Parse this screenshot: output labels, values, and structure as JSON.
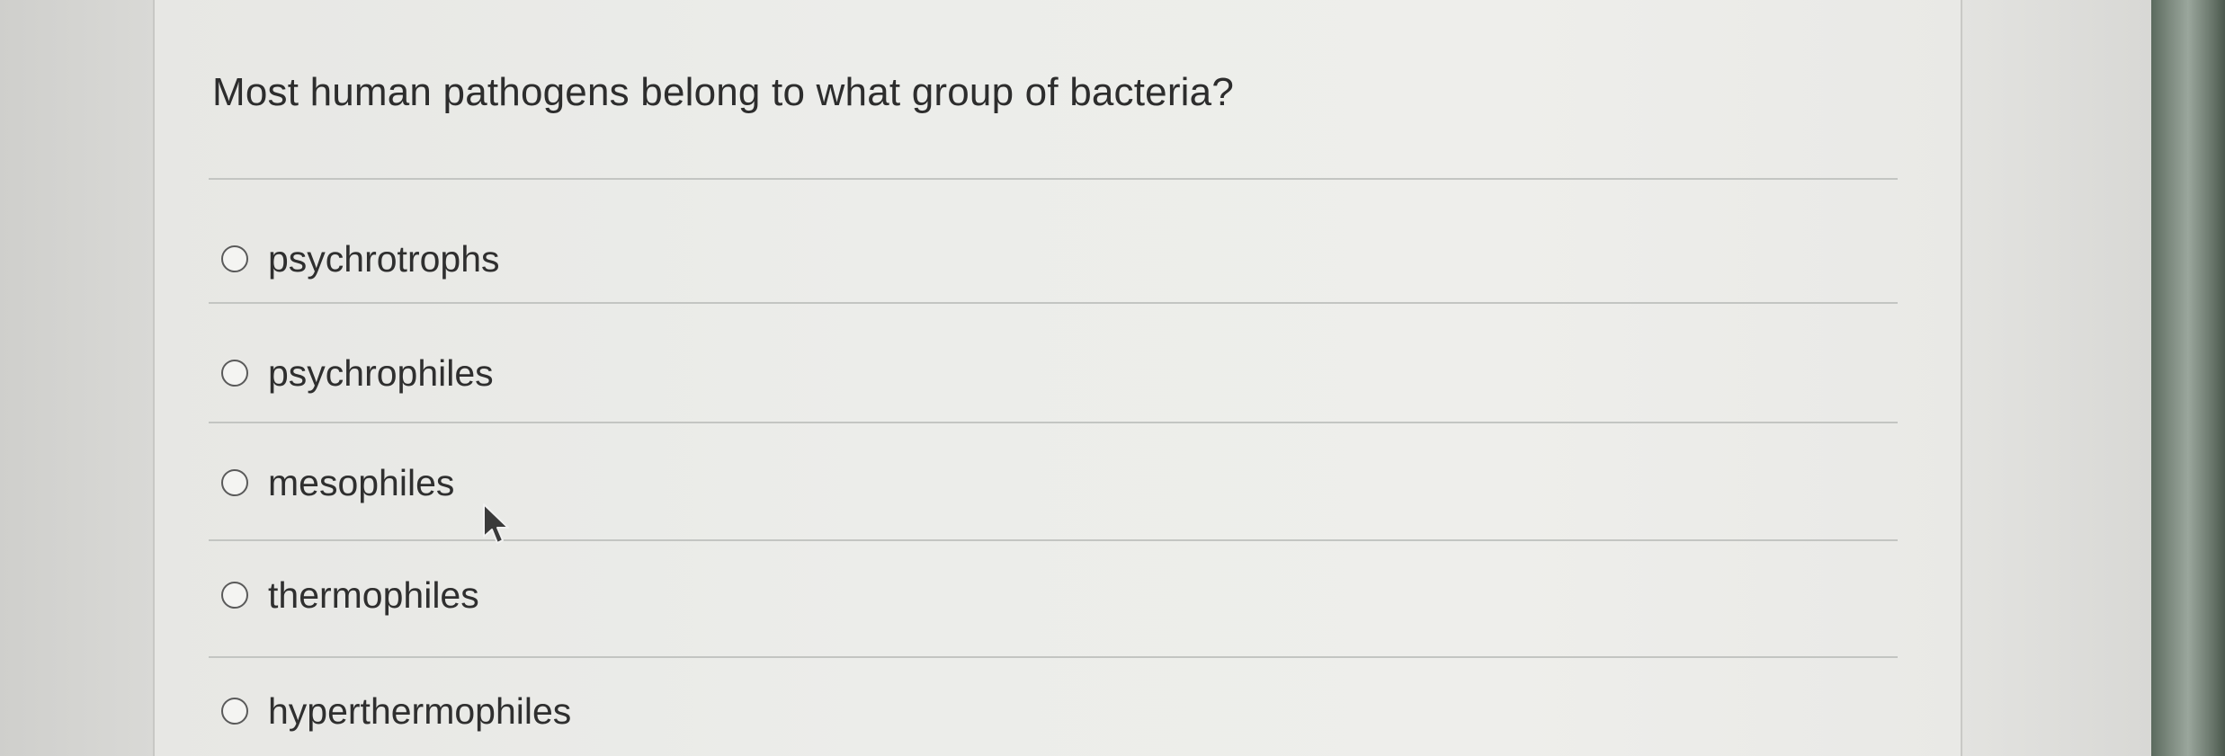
{
  "question": {
    "text": "Most human pathogens belong to what group of bacteria?"
  },
  "options": [
    {
      "label": "psychrotrophs",
      "selected": false
    },
    {
      "label": "psychrophiles",
      "selected": false
    },
    {
      "label": "mesophiles",
      "selected": false
    },
    {
      "label": "thermophiles",
      "selected": false
    },
    {
      "label": "hyperthermophiles",
      "selected": false
    }
  ],
  "cursor": {
    "icon": "mouse-pointer-icon"
  },
  "colors": {
    "panel_background": "#eceeeb",
    "text": "#2d2d2d",
    "divider": "#c3c5c2",
    "radio_border": "#5a5a5a"
  }
}
